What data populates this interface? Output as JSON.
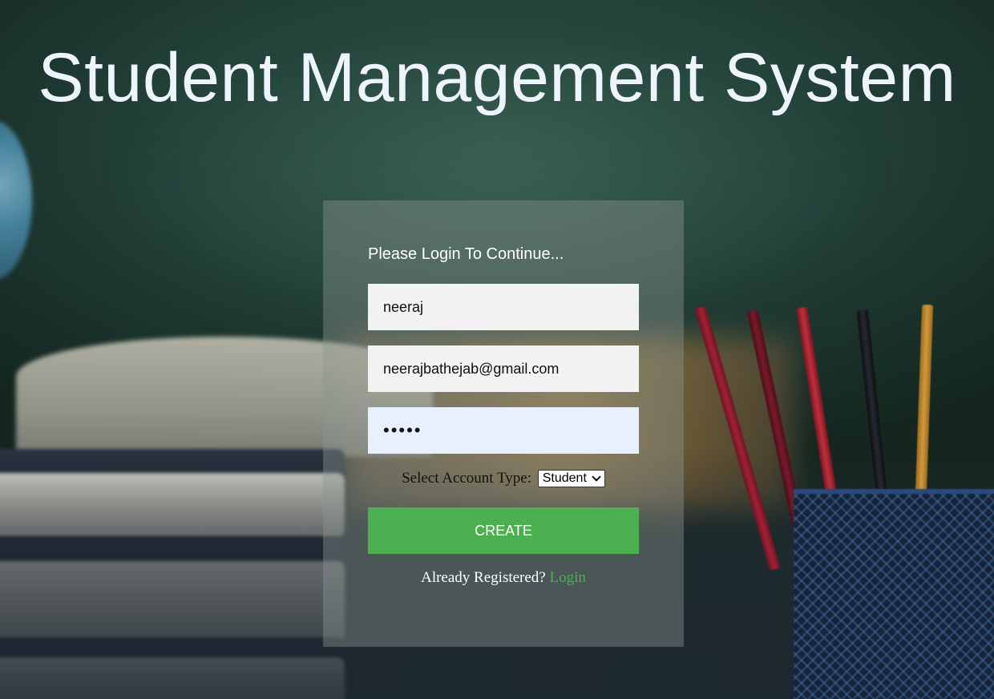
{
  "page": {
    "title": "Student Management System"
  },
  "form": {
    "heading": "Please Login To Continue...",
    "username_value": "neeraj",
    "email_value": "neerajbathejab@gmail.com",
    "password_masked": "•••••",
    "account_type_label": "Select Account Type:",
    "account_type_selected": "Student",
    "create_button_label": "CREATE",
    "already_registered_text": "Already Registered?",
    "login_link_label": "Login"
  },
  "colors": {
    "accent_green": "#4caf50",
    "autofill_blue": "#e8f0fe",
    "title_text": "#eef4fb"
  }
}
